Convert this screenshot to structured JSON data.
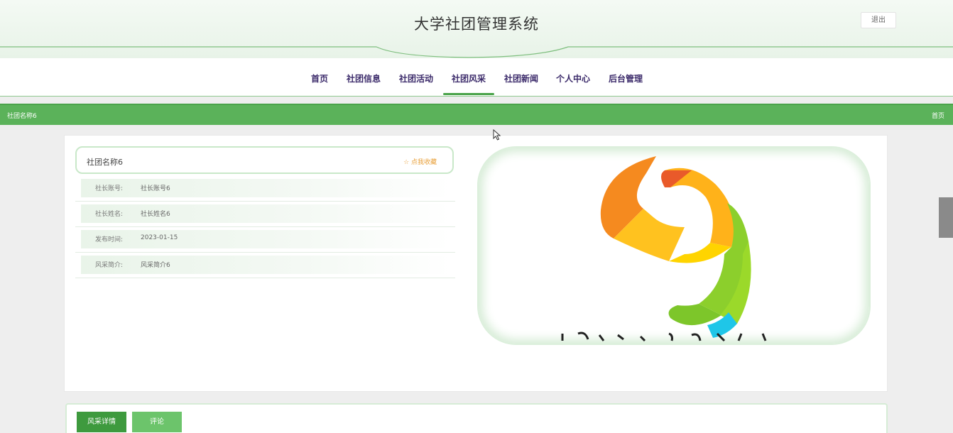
{
  "header": {
    "title": "大学社团管理系统",
    "logout_label": "退出"
  },
  "nav": {
    "items": [
      {
        "label": "首页"
      },
      {
        "label": "社团信息"
      },
      {
        "label": "社团活动"
      },
      {
        "label": "社团风采",
        "active": true
      },
      {
        "label": "社团新闻"
      },
      {
        "label": "个人中心"
      },
      {
        "label": "后台管理"
      }
    ]
  },
  "breadcrumb": {
    "current": "社团名称6",
    "home": "首页"
  },
  "detail": {
    "name": "社团名称6",
    "favorite_label": "☆ 点我收藏",
    "fields": [
      {
        "label": "社长账号:",
        "value": "社长账号6"
      },
      {
        "label": "社长姓名:",
        "value": "社长姓名6"
      },
      {
        "label": "发布时间:",
        "value": "2023-01-15"
      },
      {
        "label": "风采简介:",
        "value": "风采简介6"
      }
    ]
  },
  "tabs": {
    "detail_label": "风采详情",
    "comment_label": "评论"
  },
  "colors": {
    "accent_green": "#5bb25a",
    "dark_green": "#3e9a3e",
    "light_green": "#6cc46b",
    "favorite_orange": "#e8a03a",
    "nav_text": "#3b2a6a"
  },
  "icons": {
    "favorite": "star-outline-icon",
    "cursor": "mouse-pointer-icon"
  }
}
